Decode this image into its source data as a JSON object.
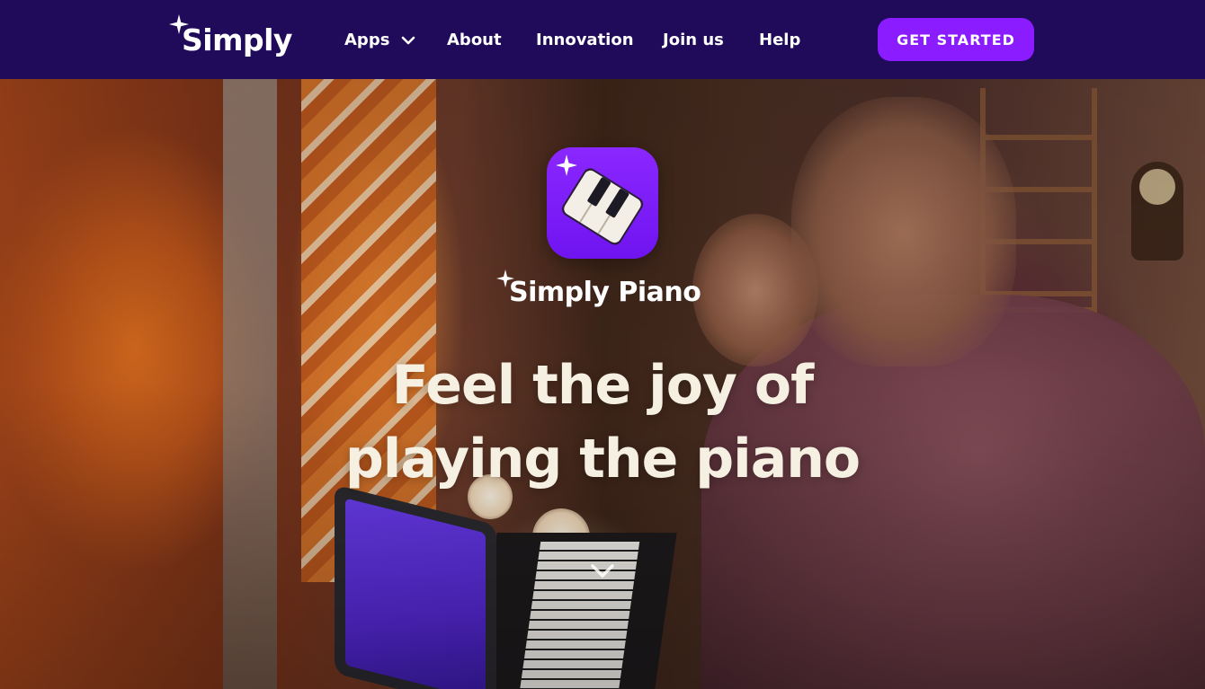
{
  "nav": {
    "logo_text": "Simply",
    "items": [
      {
        "label": "Apps",
        "has_dropdown": true
      },
      {
        "label": "About"
      },
      {
        "label": "Innovation"
      },
      {
        "label": "Join us"
      },
      {
        "label": "Help"
      }
    ],
    "cta_label": "GET STARTED"
  },
  "hero": {
    "product_name": "Simply Piano",
    "headline_line1": "Feel the joy of",
    "headline_line2": "playing the piano"
  },
  "colors": {
    "nav_background": "#200a5a",
    "cta_background": "#8a1cff",
    "app_icon_background": "#7a1cf8",
    "headline_text": "#f6f0e3"
  },
  "icons": {
    "logo_spark": "sparkle-icon",
    "apps_dropdown": "chevron-down-icon",
    "scroll": "chevron-down-icon"
  }
}
